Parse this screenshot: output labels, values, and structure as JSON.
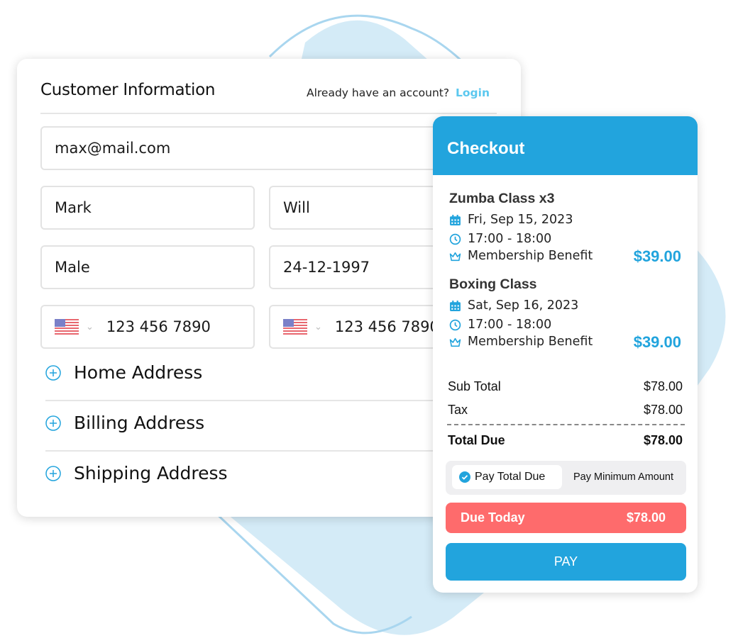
{
  "customer_info": {
    "title": "Customer Information",
    "account_prompt": "Already have an account?",
    "login_link": "Login",
    "fields": {
      "email": "max@mail.com",
      "first_name": "Mark",
      "last_name": "Will",
      "gender": "Male",
      "birth_date": "24-12-1997",
      "phone_1": "123 456 7890",
      "phone_2": "123 456 7890"
    },
    "phone_country_icon": "us-flag-icon",
    "sections": [
      {
        "label": "Home Address",
        "icon": "plus-circle-icon"
      },
      {
        "label": "Billing Address",
        "icon": "plus-circle-icon"
      },
      {
        "label": "Shipping Address",
        "icon": "plus-circle-icon"
      }
    ]
  },
  "checkout": {
    "title": "Checkout",
    "items": [
      {
        "name": "Zumba Class x3",
        "date": "Fri, Sep 15, 2023",
        "time": "17:00 - 18:00",
        "benefit": "Membership Benefit",
        "price": "$39.00"
      },
      {
        "name": "Boxing Class",
        "date": "Sat, Sep 16, 2023",
        "time": "17:00 - 18:00",
        "benefit": "Membership Benefit",
        "price": "$39.00"
      }
    ],
    "summary": {
      "subtotal_label": "Sub Total",
      "subtotal": "$78.00",
      "tax_label": "Tax",
      "tax": "$78.00",
      "total_label": "Total Due",
      "total": "$78.00"
    },
    "payment_options": {
      "selected": "Pay Total Due",
      "other": "Pay Minimum Amount"
    },
    "due_today_label": "Due Today",
    "due_today_amount": "$78.00",
    "pay_button": "PAY"
  },
  "colors": {
    "accent": "#22a4dd",
    "login_link": "#5bc8ef",
    "due_today": "#fe6b6c",
    "background_shape": "#d4ebf7"
  }
}
